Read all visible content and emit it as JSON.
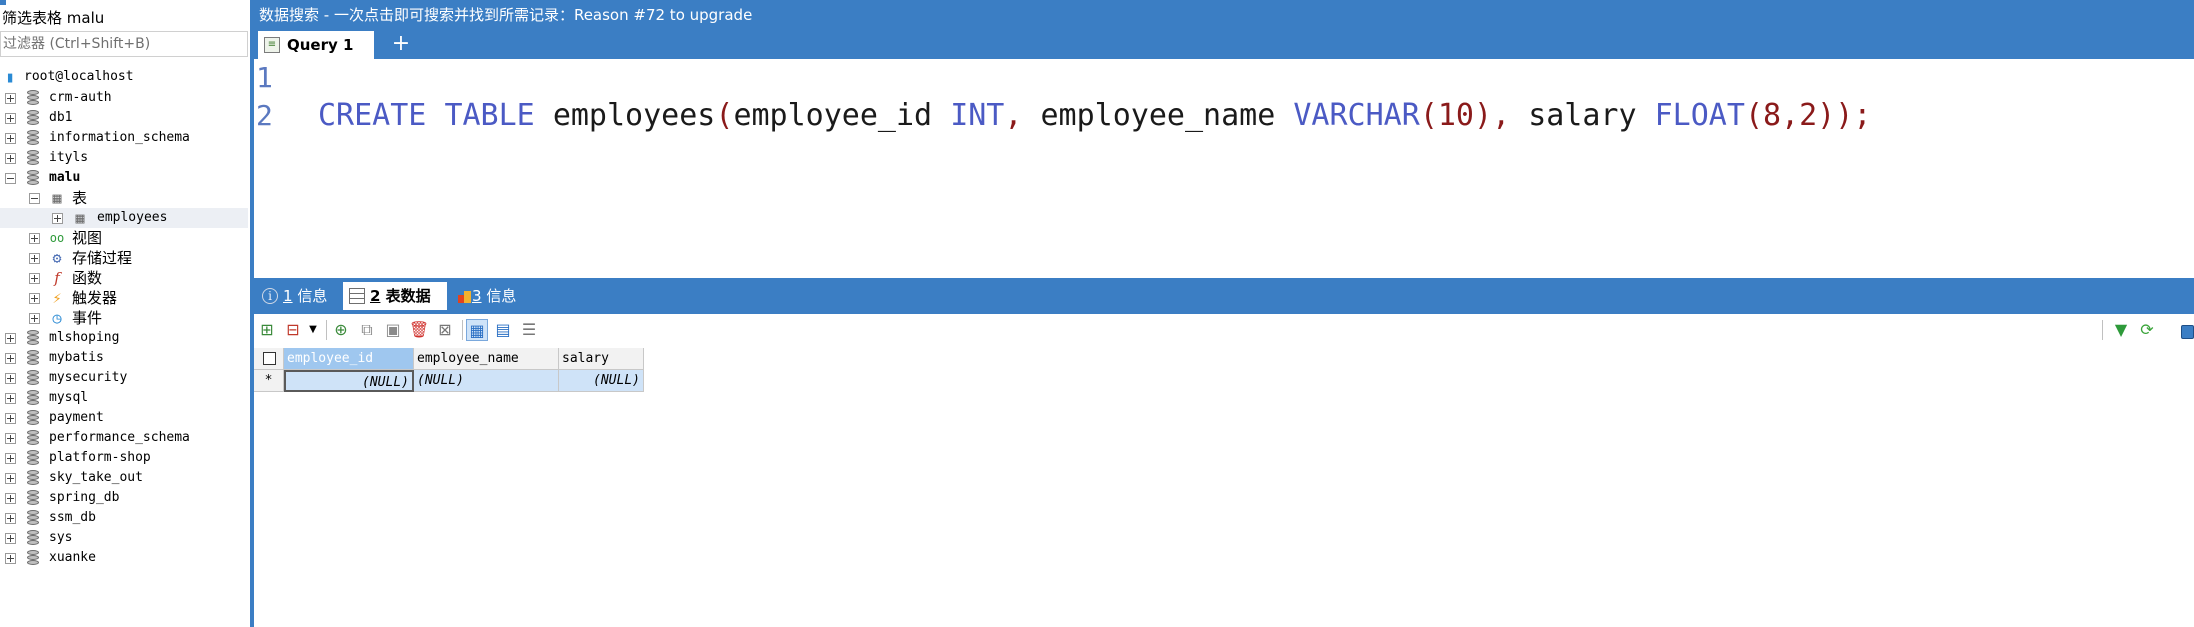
{
  "left_panel": {
    "filter_title": "筛选表格 malu",
    "filter_placeholder": "过滤器 (Ctrl+Shift+B)",
    "connection": "root@localhost",
    "databases": [
      "crm-auth",
      "db1",
      "information_schema",
      "ityls",
      "malu",
      "mlshoping",
      "mybatis",
      "mysecurity",
      "mysql",
      "payment",
      "performance_schema",
      "platform-shop",
      "sky_take_out",
      "spring_db",
      "ssm_db",
      "sys",
      "xuanke"
    ],
    "malu_children": {
      "tables_label": "表",
      "table_items": [
        "employees"
      ],
      "views_label": "视图",
      "procedures_label": "存储过程",
      "functions_label": "函数",
      "triggers_label": "触发器",
      "events_label": "事件"
    }
  },
  "title_bar": {
    "text": "数据搜索 - 一次点击即可搜索并找到所需记录：Reason #72 to upgrade"
  },
  "query_tab": {
    "label": "Query 1",
    "add_label": "+"
  },
  "editor": {
    "line_numbers": [
      "1",
      "2"
    ],
    "line1": "",
    "line2": {
      "kw_create": "CREATE",
      "kw_table": "TABLE",
      "table_name": "employees",
      "paren_open": "(",
      "col1": "employee_id",
      "type1": "INT",
      "comma1": ",",
      "col2": "employee_name",
      "type2": "VARCHAR",
      "len2": "(10)",
      "comma2": ",",
      "col3": "salary",
      "type3": "FLOAT",
      "len3": "(8,2)",
      "paren_close": ")",
      "semicolon": ";"
    }
  },
  "result_tabs": [
    {
      "num": "1",
      "label": "信息"
    },
    {
      "num": "2",
      "label": "表数据"
    },
    {
      "num": "3",
      "label": "信息"
    }
  ],
  "grid": {
    "columns": [
      "employee_id",
      "employee_name",
      "salary"
    ],
    "row_marker": "*",
    "rows": [
      [
        "(NULL)",
        "(NULL)",
        "(NULL)"
      ]
    ]
  },
  "icons": {
    "filter": "funnel-icon",
    "refresh": "refresh-icon"
  },
  "colors": {
    "accent": "#3b7ec4",
    "keyword": "#4b5ac4",
    "punctuation": "#8a1a1a",
    "line_number": "#5b79c0"
  }
}
